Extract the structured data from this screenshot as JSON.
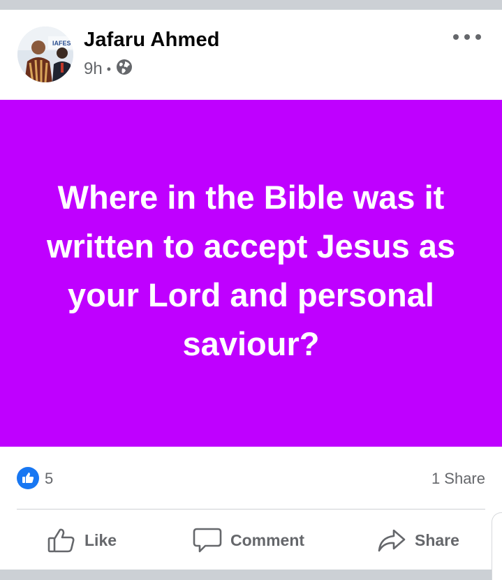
{
  "post": {
    "author_name": "Jafaru Ahmed",
    "time": "9h",
    "separator": "•",
    "privacy_icon": "globe-icon",
    "more_icon": "more-horizontal-icon",
    "avatar_badge_text": "IAFES",
    "banner_text": "Where in the Bible was it written to accept Jesus as your Lord and personal saviour?",
    "banner_color": "#bf00ff"
  },
  "reactions": {
    "icon": "thumbs-up-badge-icon",
    "like_count": "5",
    "share_count": "1 Share"
  },
  "actions": {
    "like_label": "Like",
    "comment_label": "Comment",
    "share_label": "Share"
  },
  "colors": {
    "accent": "#1877f2",
    "secondary_text": "#65676b",
    "primary_text": "#050505"
  }
}
